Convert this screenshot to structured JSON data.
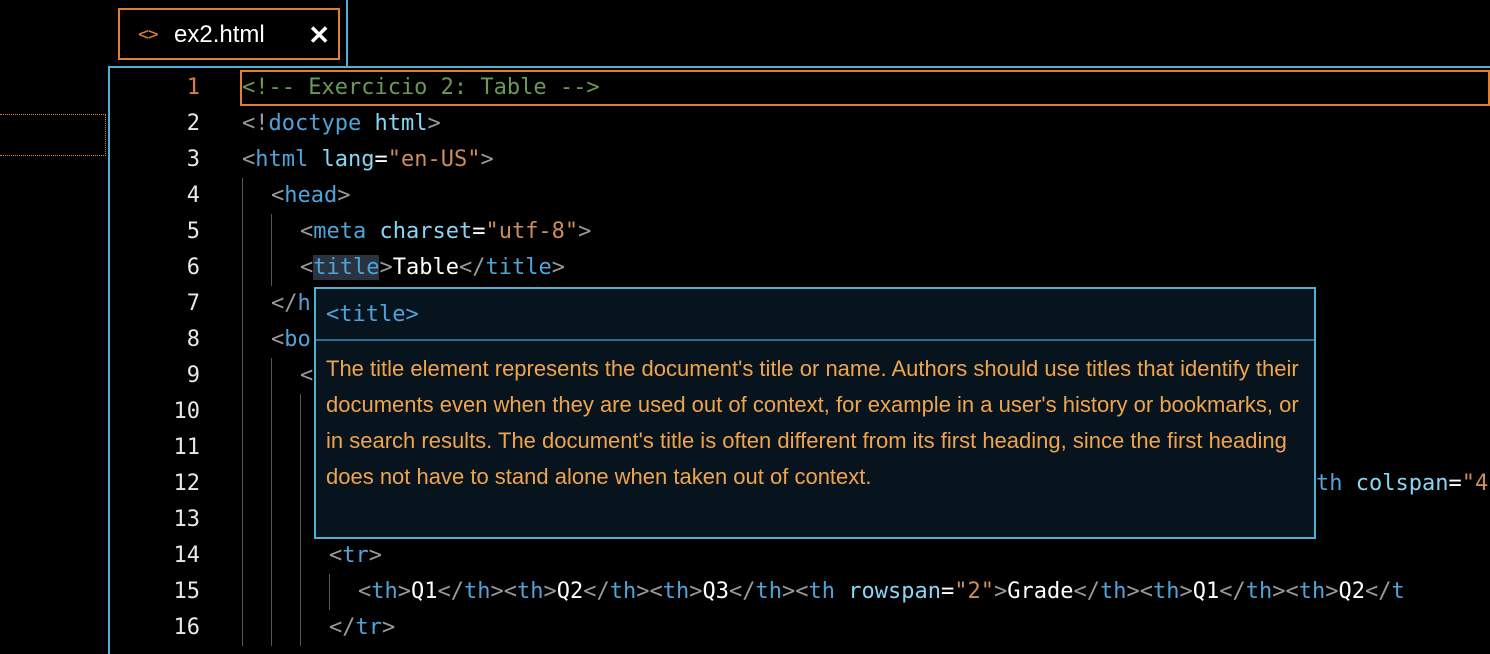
{
  "tab": {
    "icon": "code-brackets-icon",
    "icon_glyph": "<>",
    "filename": "ex2.html",
    "close_glyph": "✕"
  },
  "gutter": {
    "line_numbers": [
      "1",
      "2",
      "3",
      "4",
      "5",
      "6",
      "7",
      "8",
      "9",
      "10",
      "11",
      "12",
      "13",
      "14",
      "15",
      "16"
    ],
    "active_line": "1"
  },
  "code": {
    "l1": "<!-- Exercicio 2: Table -->",
    "l2": {
      "open": "<!",
      "kw": "doctype",
      "sp": " ",
      "val": "html",
      "close": ">"
    },
    "l3": {
      "open": "<",
      "tag": "html",
      "sp": " ",
      "attr": "lang",
      "eq": "=",
      "str": "\"en-US\"",
      "close": ">"
    },
    "l4": {
      "open": "<",
      "tag": "head",
      "close": ">"
    },
    "l5": {
      "open": "<",
      "tag": "meta",
      "sp": " ",
      "attr": "charset",
      "eq": "=",
      "str": "\"utf-8\"",
      "close": ">"
    },
    "l6": {
      "open": "<",
      "tag": "title",
      "close": ">",
      "text": "Table",
      "open2": "</",
      "tag2": "title",
      "close2": ">"
    },
    "l7": {
      "open": "</",
      "tag_partial": "h"
    },
    "l8": {
      "open": "<",
      "tag_partial": "bo"
    },
    "l9": {
      "open": "<"
    },
    "l12": {
      "tag_partial": "th",
      "sp": " ",
      "attr": "colspan",
      "eq": "=",
      "str_partial": "\"4"
    },
    "l14": {
      "open": "<",
      "tag": "tr",
      "close": ">"
    },
    "l15": {
      "a1": "<",
      "t1": "th",
      "a2": ">",
      "v1": "Q1",
      "a3": "</",
      "t2": "th",
      "a4": "><",
      "t3": "th",
      "a5": ">",
      "v2": "Q2",
      "a6": "</",
      "t4": "th",
      "a7": "><",
      "t5": "th",
      "a8": ">",
      "v3": "Q3",
      "a9": "</",
      "t6": "th",
      "a10": "><",
      "t7": "th",
      "sp": " ",
      "attr": "rowspan",
      "eq": "=",
      "str": "\"2\"",
      "a11": ">",
      "v4": "Grade",
      "a12": "</",
      "t8": "th",
      "a13": "><",
      "t9": "th",
      "a14": ">",
      "v5": "Q1",
      "a15": "</",
      "t10": "th",
      "a16": "><",
      "t11": "th",
      "a17": ">",
      "v6": "Q2",
      "a18": "</",
      "t12_partial": "t"
    },
    "l16": {
      "open": "</",
      "tag": "tr",
      "close": ">"
    }
  },
  "tooltip": {
    "header": "<title>",
    "body": "The title element represents the document's title or name. Authors should use titles that identify their documents even when they are used out of context, for example in a user's history or bookmarks, or in search results. The document's title is often different from its first heading, since the first heading does not have to stand alone when taken out of context."
  },
  "colors": {
    "accent_orange": "#e0802c",
    "accent_blue": "#4fb0d3",
    "tooltip_text": "#f0a54c",
    "comment": "#6a9955"
  }
}
